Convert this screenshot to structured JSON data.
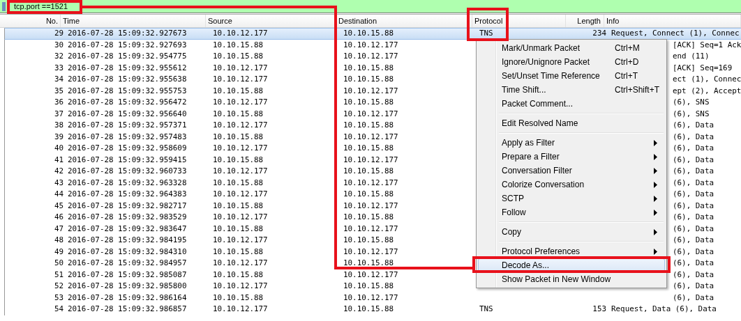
{
  "filter": {
    "value": "tcp.port ==1521"
  },
  "table": {
    "columns": [
      "No.",
      "Time",
      "Source",
      "Destination",
      "Protocol",
      "Length",
      "Info"
    ],
    "rows": [
      {
        "no": "29",
        "time": "2016-07-28 15:09:32.927673",
        "source": "10.10.12.177",
        "destination": "10.10.15.88",
        "protocol": "TNS",
        "length": "234",
        "info": "Request, Connect (1), Connec",
        "selected": true
      },
      {
        "no": "30",
        "time": "2016-07-28 15:09:32.927693",
        "source": "10.10.15.88",
        "destination": "10.10.12.177",
        "info": "[ACK] Seq=1 Ack",
        "selected": false
      },
      {
        "no": "32",
        "time": "2016-07-28 15:09:32.954775",
        "source": "10.10.15.88",
        "destination": "10.10.12.177",
        "info": "end (11)",
        "selected": false
      },
      {
        "no": "33",
        "time": "2016-07-28 15:09:32.955612",
        "source": "10.10.12.177",
        "destination": "10.10.15.88",
        "info": "[ACK] Seq=169",
        "selected": false
      },
      {
        "no": "34",
        "time": "2016-07-28 15:09:32.955638",
        "source": "10.10.12.177",
        "destination": "10.10.15.88",
        "info": "ect (1), Connec",
        "selected": false
      },
      {
        "no": "35",
        "time": "2016-07-28 15:09:32.955753",
        "source": "10.10.15.88",
        "destination": "10.10.12.177",
        "info": "ept (2), Accept",
        "selected": false
      },
      {
        "no": "36",
        "time": "2016-07-28 15:09:32.956472",
        "source": "10.10.12.177",
        "destination": "10.10.15.88",
        "info": "(6), SNS",
        "selected": false
      },
      {
        "no": "37",
        "time": "2016-07-28 15:09:32.956640",
        "source": "10.10.15.88",
        "destination": "10.10.12.177",
        "info": "(6), SNS",
        "selected": false
      },
      {
        "no": "38",
        "time": "2016-07-28 15:09:32.957371",
        "source": "10.10.12.177",
        "destination": "10.10.15.88",
        "info": "(6), Data",
        "selected": false
      },
      {
        "no": "39",
        "time": "2016-07-28 15:09:32.957483",
        "source": "10.10.15.88",
        "destination": "10.10.12.177",
        "info": "(6), Data",
        "selected": false
      },
      {
        "no": "40",
        "time": "2016-07-28 15:09:32.958609",
        "source": "10.10.12.177",
        "destination": "10.10.15.88",
        "info": "(6), Data",
        "selected": false
      },
      {
        "no": "41",
        "time": "2016-07-28 15:09:32.959415",
        "source": "10.10.15.88",
        "destination": "10.10.12.177",
        "info": "(6), Data",
        "selected": false
      },
      {
        "no": "42",
        "time": "2016-07-28 15:09:32.960733",
        "source": "10.10.12.177",
        "destination": "10.10.15.88",
        "info": "(6), Data",
        "selected": false
      },
      {
        "no": "43",
        "time": "2016-07-28 15:09:32.963328",
        "source": "10.10.15.88",
        "destination": "10.10.12.177",
        "info": "(6), Data",
        "selected": false
      },
      {
        "no": "44",
        "time": "2016-07-28 15:09:32.964383",
        "source": "10.10.12.177",
        "destination": "10.10.15.88",
        "info": "(6), Data",
        "selected": false
      },
      {
        "no": "45",
        "time": "2016-07-28 15:09:32.982717",
        "source": "10.10.15.88",
        "destination": "10.10.12.177",
        "info": "(6), Data",
        "selected": false
      },
      {
        "no": "46",
        "time": "2016-07-28 15:09:32.983529",
        "source": "10.10.12.177",
        "destination": "10.10.15.88",
        "info": "(6), Data",
        "selected": false
      },
      {
        "no": "47",
        "time": "2016-07-28 15:09:32.983647",
        "source": "10.10.15.88",
        "destination": "10.10.12.177",
        "info": "(6), Data",
        "selected": false
      },
      {
        "no": "48",
        "time": "2016-07-28 15:09:32.984195",
        "source": "10.10.12.177",
        "destination": "10.10.15.88",
        "info": "(6), Data",
        "selected": false
      },
      {
        "no": "49",
        "time": "2016-07-28 15:09:32.984310",
        "source": "10.10.15.88",
        "destination": "10.10.12.177",
        "info": "(6), Data",
        "selected": false
      },
      {
        "no": "50",
        "time": "2016-07-28 15:09:32.984957",
        "source": "10.10.12.177",
        "destination": "10.10.15.88",
        "info": "(6), Data",
        "selected": false
      },
      {
        "no": "51",
        "time": "2016-07-28 15:09:32.985087",
        "source": "10.10.15.88",
        "destination": "10.10.12.177",
        "info": "(6), Data",
        "selected": false
      },
      {
        "no": "52",
        "time": "2016-07-28 15:09:32.985800",
        "source": "10.10.12.177",
        "destination": "10.10.15.88",
        "info": "(6), Data",
        "selected": false
      },
      {
        "no": "53",
        "time": "2016-07-28 15:09:32.986164",
        "source": "10.10.15.88",
        "destination": "10.10.12.177",
        "info": "(6), Data",
        "selected": false
      },
      {
        "no": "54",
        "time": "2016-07-28 15:09:32.986857",
        "source": "10.10.12.177",
        "destination": "10.10.15.88",
        "protocol": "TNS",
        "length": "153",
        "info": "Request, Data (6), Data",
        "selected": false
      }
    ]
  },
  "context_menu": {
    "items": [
      {
        "kind": "item",
        "label": "Mark/Unmark Packet",
        "shortcut": "Ctrl+M",
        "submenu": false,
        "selected": false
      },
      {
        "kind": "item",
        "label": "Ignore/Unignore Packet",
        "shortcut": "Ctrl+D",
        "submenu": false,
        "selected": false
      },
      {
        "kind": "item",
        "label": "Set/Unset Time Reference",
        "shortcut": "Ctrl+T",
        "submenu": false,
        "selected": false
      },
      {
        "kind": "item",
        "label": "Time Shift...",
        "shortcut": "Ctrl+Shift+T",
        "submenu": false,
        "selected": false
      },
      {
        "kind": "item",
        "label": "Packet Comment...",
        "submenu": false,
        "selected": false
      },
      {
        "kind": "separator"
      },
      {
        "kind": "item",
        "label": "Edit Resolved Name",
        "submenu": false,
        "selected": false
      },
      {
        "kind": "separator"
      },
      {
        "kind": "item",
        "label": "Apply as Filter",
        "submenu": true,
        "selected": false
      },
      {
        "kind": "item",
        "label": "Prepare a Filter",
        "submenu": true,
        "selected": false
      },
      {
        "kind": "item",
        "label": "Conversation Filter",
        "submenu": true,
        "selected": false
      },
      {
        "kind": "item",
        "label": "Colorize Conversation",
        "submenu": true,
        "selected": false
      },
      {
        "kind": "item",
        "label": "SCTP",
        "submenu": true,
        "selected": false
      },
      {
        "kind": "item",
        "label": "Follow",
        "submenu": true,
        "selected": false
      },
      {
        "kind": "separator"
      },
      {
        "kind": "item",
        "label": "Copy",
        "submenu": true,
        "selected": false
      },
      {
        "kind": "separator"
      },
      {
        "kind": "item",
        "label": "Protocol Preferences",
        "submenu": true,
        "selected": false
      },
      {
        "kind": "item",
        "label": "Decode As...",
        "submenu": false,
        "selected": true
      },
      {
        "kind": "item",
        "label": "Show Packet in New Window",
        "submenu": false,
        "selected": false
      }
    ]
  }
}
